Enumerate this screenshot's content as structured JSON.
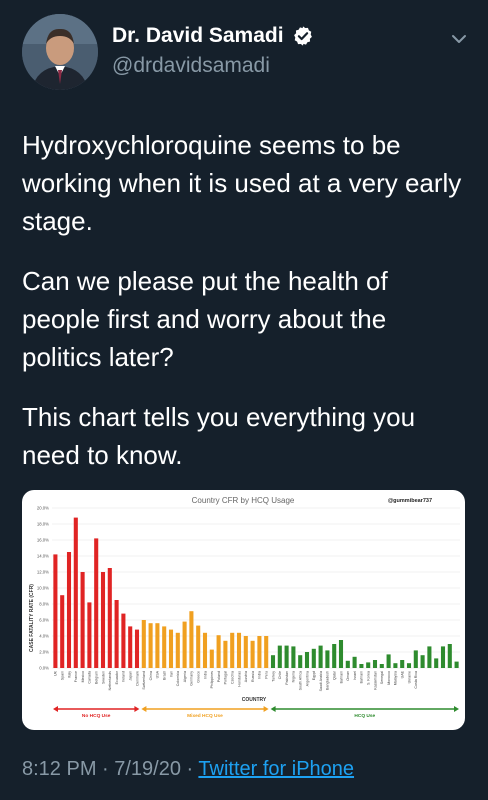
{
  "author": {
    "name": "Dr. David Samadi",
    "handle": "@drdavidsamadi"
  },
  "tweet": {
    "paragraph1": "Hydroxychloroquine seems to be working when it is used at a very early stage.",
    "paragraph2": "Can we please put the health of people first and worry about the politics later?",
    "paragraph3": "This chart tells you everything you need to know."
  },
  "footer": {
    "time_date": "8:12 PM · 7/19/20 · ",
    "source": "Twitter for iPhone"
  },
  "colors": {
    "background": "#15202b",
    "no_hcq": "#e02424",
    "mixed_hcq": "#f0a020",
    "hcq": "#2e8b2e"
  },
  "chart_data": {
    "type": "bar",
    "title": "Country CFR by HCQ Usage",
    "watermark": "@gummibear737",
    "xlabel": "COUNTRY",
    "ylabel": "CASE FATALITY RATE (CFR)",
    "ylim": [
      0,
      20
    ],
    "yticks": [
      "0.0%",
      "2.0%",
      "4.0%",
      "6.0%",
      "8.0%",
      "10.0%",
      "12.0%",
      "14.0%",
      "16.0%",
      "18.0%",
      "20.0%"
    ],
    "categories": [
      "UK",
      "Spain",
      "Italy",
      "France",
      "Mexico",
      "Canada",
      "Belgium",
      "Sweden",
      "Netherlands",
      "Ecuador",
      "Ireland",
      "Japan",
      "Denmark",
      "Switzerland",
      "China",
      "USA",
      "Brazil",
      "Iran",
      "Colombia",
      "Algeria",
      "Germany",
      "Greece",
      "India",
      "Philippines",
      "Poland",
      "Portugal",
      "Czechia",
      "Honduras",
      "Austria",
      "Russia",
      "India",
      "Peru",
      "Turkey",
      "Chile",
      "Pakistan",
      "Nigeria",
      "South Africa",
      "Argentina",
      "Egypt",
      "Saudi Arabia",
      "Bangladesh",
      "Qatar",
      "Bahrain",
      "Oman",
      "Israel",
      "Bahrain",
      "S. Korea",
      "Kazakhstan",
      "Senegal",
      "Morocco",
      "Malaysia",
      "UAE",
      "Ukraine",
      "Costa Rica"
    ],
    "series": [
      {
        "name": "No HCQ Use",
        "values": [
          14.2,
          9.1,
          14.5,
          18.8,
          12.0,
          8.2,
          16.2,
          12.0,
          12.5,
          8.5,
          6.8,
          5.2,
          4.8
        ]
      },
      {
        "name": "Mixed HCQ Use",
        "values": [
          6.0,
          5.6,
          5.6,
          5.2,
          4.8,
          4.4,
          5.8,
          7.1,
          5.3,
          4.4,
          2.3,
          4.1,
          3.4,
          4.4,
          4.4,
          4.0,
          3.4,
          4.0,
          4.0
        ]
      },
      {
        "name": "HCQ Use",
        "values": [
          1.6,
          2.8,
          2.8,
          2.7,
          1.6,
          2.0,
          2.4,
          2.8,
          2.2,
          3.0,
          3.5,
          0.9,
          1.4,
          0.5,
          0.7,
          1.0,
          0.5,
          1.7,
          0.6,
          1.0,
          0.6,
          2.2,
          1.6,
          2.7,
          1.2,
          2.7,
          3.0,
          0.8
        ]
      }
    ],
    "legend": [
      "No HCQ Use",
      "Mixed HCQ Use",
      "HCQ Use"
    ],
    "grid": true
  }
}
